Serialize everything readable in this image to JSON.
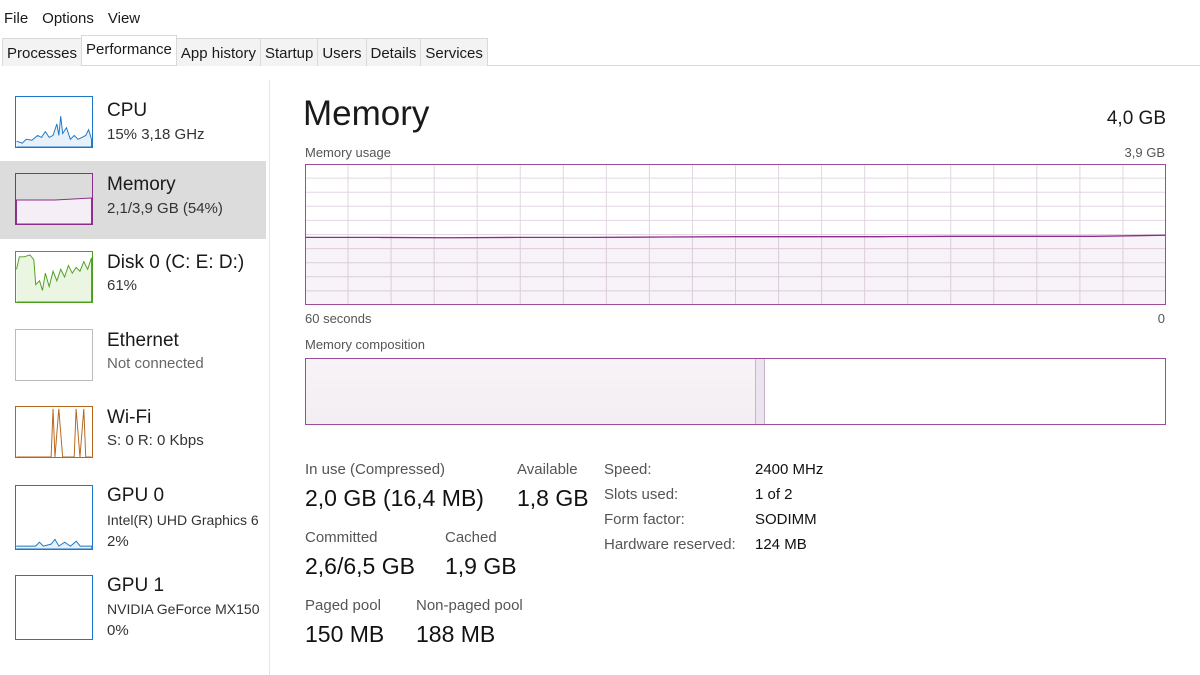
{
  "menu": [
    "File",
    "Options",
    "View"
  ],
  "tabs": [
    "Processes",
    "Performance",
    "App history",
    "Startup",
    "Users",
    "Details",
    "Services"
  ],
  "sidebar": [
    {
      "name": "CPU",
      "sub": "15% 3,18 GHz",
      "color": "#1e78c8"
    },
    {
      "name": "Memory",
      "sub": "2,1/3,9 GB (54%)",
      "color": "#8b2d8b"
    },
    {
      "name": "Disk 0 (C: E: D:)",
      "sub": "61%",
      "color": "#4da01e"
    },
    {
      "name": "Ethernet",
      "sub": "Not connected",
      "color": "#aaaaaa"
    },
    {
      "name": "Wi-Fi",
      "sub": "S: 0 R: 0 Kbps",
      "color": "#b5651d"
    },
    {
      "name": "GPU 0",
      "sub": "Intel(R) UHD Graphics 6",
      "sub2": "2%",
      "color": "#1e78c8"
    },
    {
      "name": "GPU 1",
      "sub": "NVIDIA GeForce MX150",
      "sub2": "0%",
      "color": "#1e78c8"
    }
  ],
  "main": {
    "title": "Memory",
    "total": "4,0 GB",
    "usage_label": "Memory usage",
    "usage_max": "3,9 GB",
    "time_left": "60 seconds",
    "time_right": "0",
    "composition_label": "Memory composition",
    "stats": {
      "in_use_label": "In use (Compressed)",
      "in_use": "2,0 GB (16,4 MB)",
      "available_label": "Available",
      "available": "1,8 GB",
      "committed_label": "Committed",
      "committed": "2,6/6,5 GB",
      "cached_label": "Cached",
      "cached": "1,9 GB",
      "paged_label": "Paged pool",
      "paged": "150 MB",
      "nonpaged_label": "Non-paged pool",
      "nonpaged": "188 MB"
    },
    "details": [
      {
        "k": "Speed:",
        "v": "2400 MHz"
      },
      {
        "k": "Slots used:",
        "v": "1 of 2"
      },
      {
        "k": "Form factor:",
        "v": "SODIMM"
      },
      {
        "k": "Hardware reserved:",
        "v": "124 MB"
      }
    ],
    "accent": "#8b2d8b"
  },
  "chart_data": {
    "type": "area",
    "xlabel": "",
    "ylabel": "",
    "xlim": [
      60,
      0
    ],
    "ylim": [
      0,
      3.9
    ],
    "grid": true,
    "x": [
      60,
      55,
      50,
      45,
      40,
      35,
      30,
      25,
      20,
      15,
      10,
      5,
      0
    ],
    "values": [
      1.87,
      1.87,
      1.86,
      1.87,
      1.87,
      1.88,
      1.89,
      1.89,
      1.89,
      1.9,
      1.9,
      1.9,
      1.93
    ]
  }
}
